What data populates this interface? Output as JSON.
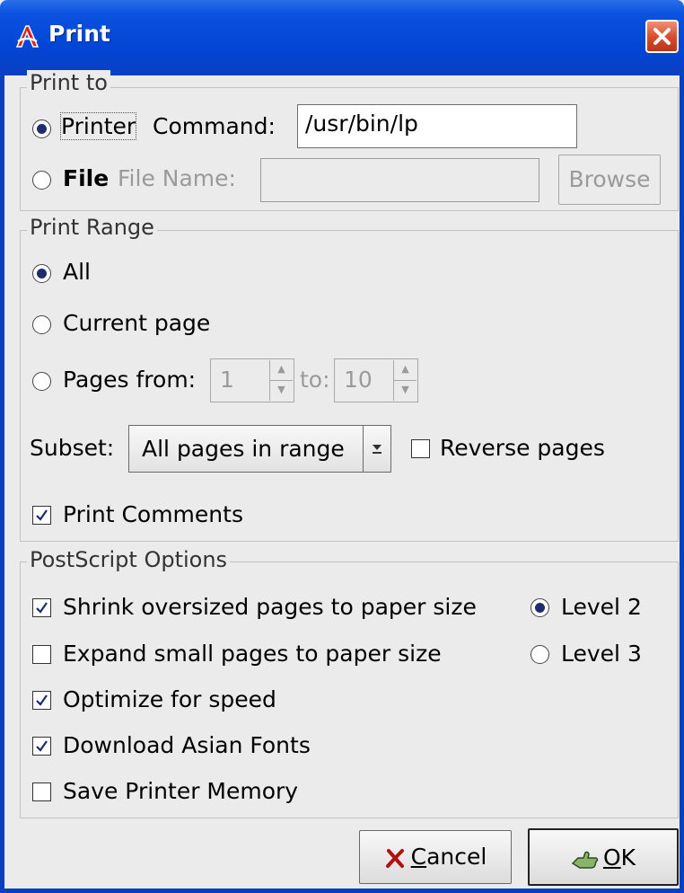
{
  "window": {
    "title": "Print"
  },
  "print_to": {
    "legend": "Print to",
    "printer_label": "Printer",
    "command_label": "Command:",
    "command_value": "/usr/bin/lp",
    "file_label": "File",
    "file_name_label": "File Name:",
    "file_name_value": "",
    "browse_label": "Browse"
  },
  "print_range": {
    "legend": "Print Range",
    "all_label": "All",
    "current_page_label": "Current page",
    "pages_from_label": "Pages from:",
    "from_value": "1",
    "to_label": "to:",
    "to_value": "10",
    "subset_label": "Subset:",
    "subset_value": "All pages in range",
    "reverse_label": "Reverse pages",
    "comments_label": "Print Comments"
  },
  "postscript": {
    "legend": "PostScript Options",
    "shrink_label": "Shrink oversized pages to paper size",
    "expand_label": "Expand small pages to paper size",
    "optimize_label": "Optimize for speed",
    "asian_fonts_label": "Download Asian Fonts",
    "save_memory_label": "Save Printer Memory",
    "level2_label": "Level 2",
    "level3_label": "Level 3"
  },
  "buttons": {
    "cancel_mnemonic": "C",
    "cancel_rest": "ancel",
    "ok_mnemonic": "O",
    "ok_rest": "K"
  }
}
